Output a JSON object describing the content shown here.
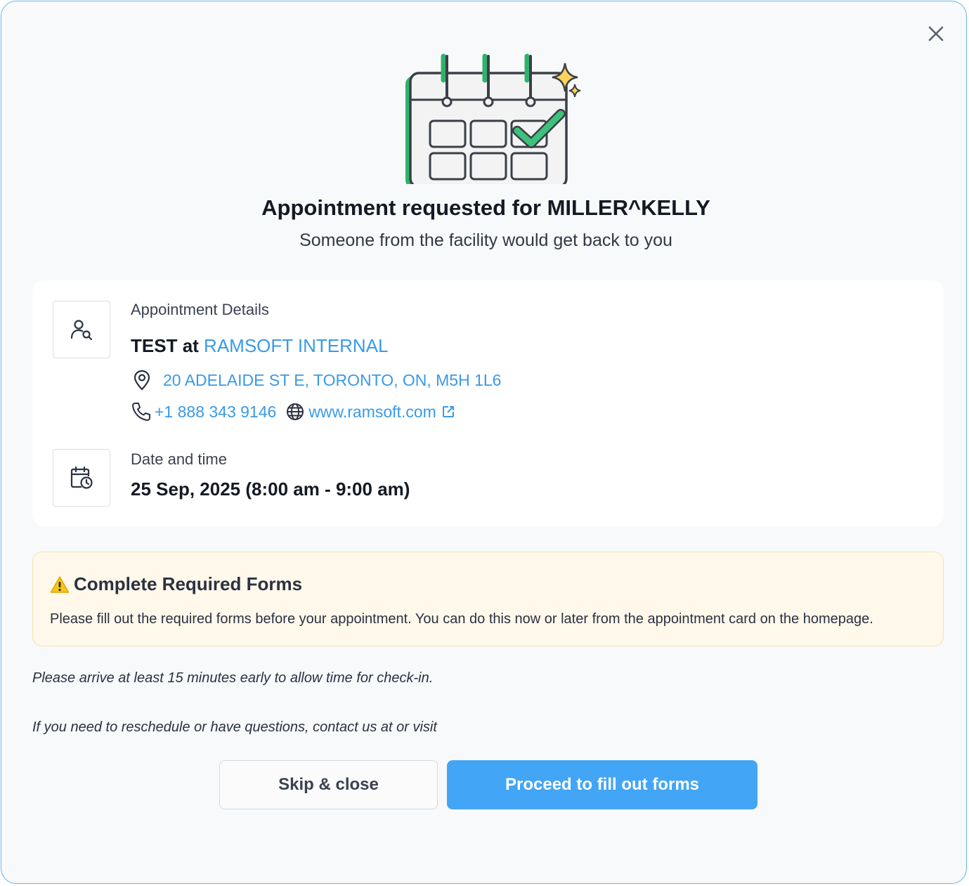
{
  "dialog": {
    "title": "Appointment requested for MILLER^KELLY",
    "subtitle": "Someone from the facility would get back to you",
    "close_icon": "close-icon",
    "illustration_icon": "calendar-check-illustration"
  },
  "appointment": {
    "section_label": "Appointment Details",
    "procedure": "TEST",
    "at_word": "at",
    "facility_name": "RAMSOFT INTERNAL",
    "address": "20 ADELAIDE ST E, TORONTO, ON, M5H 1L6",
    "phone": "+1 888 343 9146",
    "website": "www.ramsoft.com",
    "icons": {
      "details": "user-search-icon",
      "address": "map-pin-icon",
      "phone": "phone-icon",
      "website": "globe-icon",
      "external": "external-link-icon"
    }
  },
  "datetime": {
    "section_label": "Date and time",
    "value": "25 Sep, 2025 (8:00 am - 9:00 am)",
    "icon": "calendar-clock-icon"
  },
  "forms_notice": {
    "icon": "warning-icon",
    "title": "Complete Required Forms",
    "text": "Please fill out the required forms before your appointment. You can do this now or later from the appointment card on the homepage."
  },
  "notes": {
    "arrival": "Please arrive at least 15 minutes early to allow time for check-in.",
    "contact": "If you need to reschedule or have questions, contact us at or visit"
  },
  "actions": {
    "skip_label": "Skip & close",
    "proceed_label": "Proceed to fill out forms"
  },
  "colors": {
    "accent": "#43a5f5",
    "link": "#3a9ae6",
    "warning_bg": "#fff8eb",
    "success_green": "#2fb36b"
  }
}
